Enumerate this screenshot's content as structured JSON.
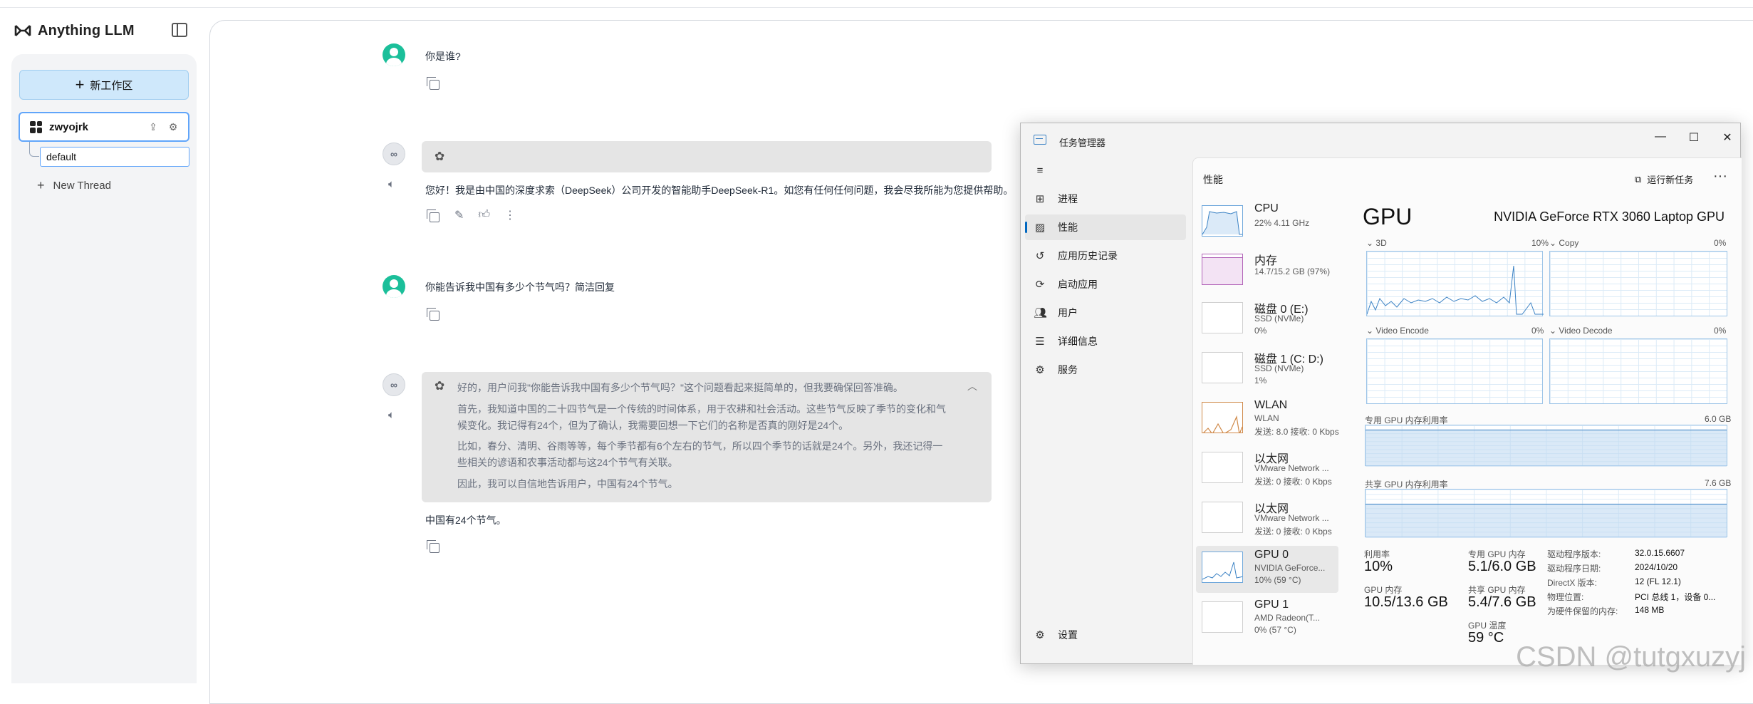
{
  "app": {
    "brand": "Anything LLM",
    "new_workspace_label": "新工作区",
    "workspace_name": "zwyojrk",
    "thread_default": "default",
    "new_thread_label": "New Thread"
  },
  "chat": {
    "q1": "你是谁?",
    "a1": "您好！我是由中国的深度求索（DeepSeek）公司开发的智能助手DeepSeek-R1。如您有任何任何问题，我会尽我所能为您提供帮助。",
    "q2": "你能告诉我中国有多少个节气吗？简洁回复",
    "think": [
      "好的，用户问我\"你能告诉我中国有多少个节气吗？\"这个问题看起来挺简单的，但我要确保回答准确。",
      "首先，我知道中国的二十四节气是一个传统的时间体系，用于农耕和社会活动。这些节气反映了季节的变化和气",
      "候变化。我记得有24个，但为了确认，我需要回想一下它们的名称是否真的刚好是24个。",
      "比如，春分、清明、谷雨等等，每个季节都有6个左右的节气，所以四个季节的话就是24个。另外，我还记得一",
      "些相关的谚语和农事活动都与这24个节气有关联。",
      "因此，我可以自信地告诉用户，中国有24个节气。"
    ],
    "a2": "中国有24个节气。"
  },
  "task_manager": {
    "title": "任务管理器",
    "nav": [
      {
        "label": "进程",
        "icon": "grid-icon"
      },
      {
        "label": "性能",
        "icon": "performance-icon"
      },
      {
        "label": "应用历史记录",
        "icon": "history-icon"
      },
      {
        "label": "启动应用",
        "icon": "startup-icon"
      },
      {
        "label": "用户",
        "icon": "users-icon"
      },
      {
        "label": "详细信息",
        "icon": "details-icon"
      },
      {
        "label": "服务",
        "icon": "services-icon"
      }
    ],
    "settings_label": "设置",
    "page_title": "性能",
    "run_task_label": "运行新任务",
    "resources": [
      {
        "name": "CPU",
        "sub1": "22% 4.11 GHz",
        "sub2": ""
      },
      {
        "name": "内存",
        "sub1": "14.7/15.2 GB (97%)",
        "sub2": ""
      },
      {
        "name": "磁盘 0 (E:)",
        "sub1": "SSD (NVMe)",
        "sub2": "0%"
      },
      {
        "name": "磁盘 1 (C: D:)",
        "sub1": "SSD (NVMe)",
        "sub2": "1%"
      },
      {
        "name": "WLAN",
        "sub1": "WLAN",
        "sub2": "发送: 8.0 接收: 0 Kbps"
      },
      {
        "name": "以太网",
        "sub1": "VMware Network ...",
        "sub2": "发送: 0 接收: 0 Kbps"
      },
      {
        "name": "以太网",
        "sub1": "VMware Network ...",
        "sub2": "发送: 0 接收: 0 Kbps"
      },
      {
        "name": "GPU 0",
        "sub1": "NVIDIA GeForce...",
        "sub2": "10% (59 °C)"
      },
      {
        "name": "GPU 1",
        "sub1": "AMD Radeon(T...",
        "sub2": "0% (57 °C)"
      }
    ],
    "gpu": {
      "heading": "GPU",
      "model": "NVIDIA GeForce RTX 3060 Laptop GPU",
      "engines": [
        {
          "name": "3D",
          "pct": "10%"
        },
        {
          "name": "Copy",
          "pct": "0%"
        },
        {
          "name": "Video Encode",
          "pct": "0%"
        },
        {
          "name": "Video Decode",
          "pct": "0%"
        }
      ],
      "dedicated_label": "专用 GPU 内存利用率",
      "dedicated_max": "6.0 GB",
      "shared_label": "共享 GPU 内存利用率",
      "shared_max": "7.6 GB",
      "stats": {
        "util_label": "利用率",
        "util_value": "10%",
        "dedicated_mem_label": "专用 GPU 内存",
        "dedicated_mem_value": "5.1/6.0 GB",
        "gpu_mem_label": "GPU 内存",
        "gpu_mem_value": "10.5/13.6 GB",
        "shared_mem_label": "共享 GPU 内存",
        "shared_mem_value": "5.4/7.6 GB",
        "temp_label": "GPU 温度",
        "temp_value": "59 °C"
      },
      "info": [
        {
          "k": "驱动程序版本:",
          "v": "32.0.15.6607"
        },
        {
          "k": "驱动程序日期:",
          "v": "2024/10/20"
        },
        {
          "k": "DirectX 版本:",
          "v": "12 (FL 12.1)"
        },
        {
          "k": "物理位置:",
          "v": "PCI 总线 1，设备 0..."
        },
        {
          "k": "为硬件保留的内存:",
          "v": "148 MB"
        }
      ]
    }
  },
  "watermark": "CSDN @tutgxuzyj"
}
